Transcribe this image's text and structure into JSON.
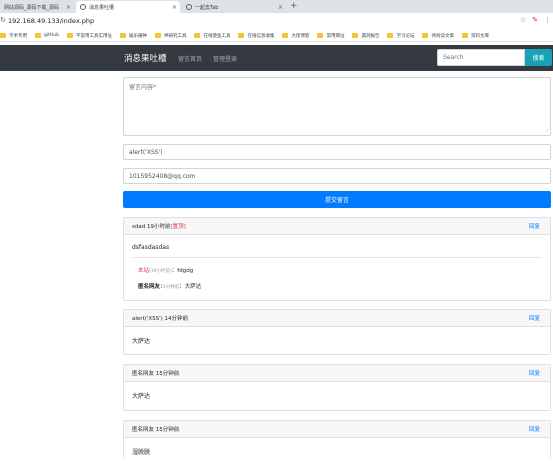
{
  "browser": {
    "tabs": [
      {
        "label": "网站源码_源码下载_源码",
        "active": false
      },
      {
        "label": "消息果吐槽",
        "active": true
      },
      {
        "label": "一起去Tab",
        "active": false
      }
    ],
    "new_tab": "+",
    "url": "192.168.49.133/index.php",
    "bookmarks": [
      "学术专用",
      "gitHub",
      "不常用工具实用址",
      "娱乐播钟",
      "神研究工具",
      "在线使鱼工具",
      "在线信息收集",
      "大佬博客",
      "常用网址",
      "漏洞报告",
      "学习论坛",
      "待阅读文章",
      "资料文库"
    ]
  },
  "nav": {
    "brand": "消息果吐槽",
    "links": [
      "留言首页",
      "管理登录"
    ],
    "search_placeholder": "Search",
    "search_button": "搜索"
  },
  "form": {
    "message_placeholder": "留言内容*",
    "name_value": "alert('XSS')",
    "email_value": "1015952408@qq.com",
    "submit_label": "提交留言"
  },
  "messages": [
    {
      "header": "sdad 19小时前",
      "hot": "[置顶]",
      "reply": "回复",
      "body": "dsfasdasdas",
      "replies": [
        {
          "name": "本站",
          "meta": "(19小时前)",
          "sep": "：",
          "text": "fdgdg"
        },
        {
          "name": "匿名网友",
          "meta": "15分钟前",
          "sep": "：",
          "text": "大萨达"
        }
      ]
    },
    {
      "header": "alert('XSS') 14分钟前",
      "reply": "回复",
      "body": "大萨达"
    },
    {
      "header": "匿名网友 15分钟前",
      "reply": "回复",
      "body": "大萨达"
    },
    {
      "header": "匿名网友 15分钟前",
      "reply": "回复",
      "body": "湿脱脱"
    }
  ]
}
